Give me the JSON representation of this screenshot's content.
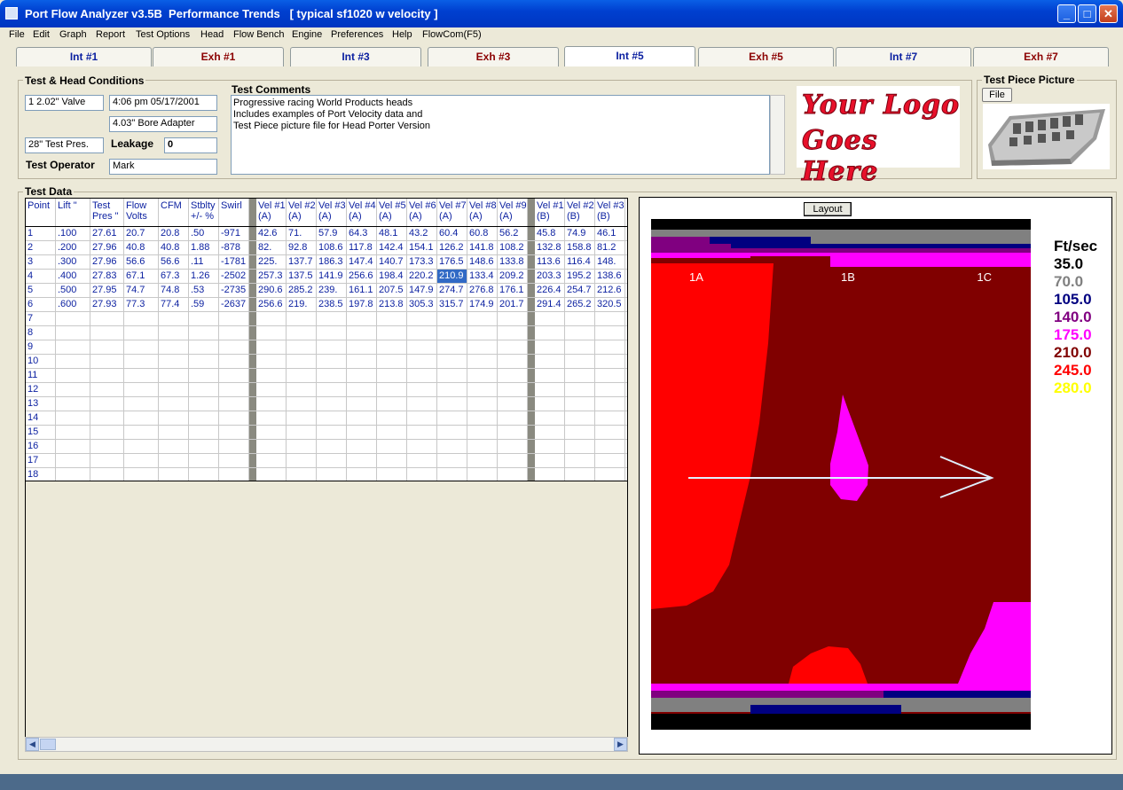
{
  "window": {
    "title": "Port Flow Analyzer v3.5B  Performance Trends   [ typical sf1020 w velocity ]"
  },
  "menu": [
    "File",
    "Edit",
    "Graph",
    "Report",
    "Test Options",
    "Head",
    "Flow Bench",
    "Engine",
    "Preferences",
    "Help",
    "FlowCom(F5)"
  ],
  "tabs": [
    {
      "label": "Int #1",
      "kind": "int"
    },
    {
      "label": "Exh #1",
      "kind": "exh"
    },
    {
      "label": "Int #3",
      "kind": "int"
    },
    {
      "label": "Exh #3",
      "kind": "exh"
    },
    {
      "label": "Int #5",
      "kind": "int",
      "active": true
    },
    {
      "label": "Exh #5",
      "kind": "exh"
    },
    {
      "label": "Int #7",
      "kind": "int"
    },
    {
      "label": "Exh #7",
      "kind": "exh"
    }
  ],
  "conditions": {
    "group_label": "Test & Head Conditions",
    "valve": "1  2.02\" Valve",
    "datetime": "4:06 pm  05/17/2001",
    "bore_adapter": "4.03\" Bore Adapter",
    "test_pres": "28\" Test Pres.",
    "leakage_label": "Leakage",
    "leakage_value": "0",
    "operator_label": "Test Operator",
    "operator_value": "Mark"
  },
  "comments": {
    "label": "Test Comments",
    "lines": [
      "Progressive racing World Products heads",
      "Includes examples of Port Velocity data and",
      "Test Piece picture file for Head Porter Version"
    ]
  },
  "logo": {
    "line1": "Your Logo",
    "line2": "Goes Here"
  },
  "picture": {
    "label": "Test Piece Picture",
    "file_button": "File"
  },
  "test_data": {
    "label": "Test Data",
    "columns": [
      "Point",
      "Lift \"",
      "Test Pres \"",
      "Flow Volts",
      "CFM",
      "Stblty +/- %",
      "Swirl",
      "Vel #1 (A)",
      "Vel #2 (A)",
      "Vel #3 (A)",
      "Vel #4 (A)",
      "Vel #5 (A)",
      "Vel #6 (A)",
      "Vel #7 (A)",
      "Vel #8 (A)",
      "Vel #9 (A)",
      "Vel #1 (B)",
      "Vel #2 (B)",
      "Vel #3 (B)"
    ],
    "rows": [
      [
        "1",
        ".100",
        "27.61",
        "20.7",
        "20.8",
        ".50",
        "-971",
        "42.6",
        "71.",
        "57.9",
        "64.3",
        "48.1",
        "43.2",
        "60.4",
        "60.8",
        "56.2",
        "45.8",
        "74.9",
        "46.1"
      ],
      [
        "2",
        ".200",
        "27.96",
        "40.8",
        "40.8",
        "1.88",
        "-878",
        "82.",
        "92.8",
        "108.6",
        "117.8",
        "142.4",
        "154.1",
        "126.2",
        "141.8",
        "108.2",
        "132.8",
        "158.8",
        "81.2"
      ],
      [
        "3",
        ".300",
        "27.96",
        "56.6",
        "56.6",
        ".11",
        "-1781",
        "225.",
        "137.7",
        "186.3",
        "147.4",
        "140.7",
        "173.3",
        "176.5",
        "148.6",
        "133.8",
        "113.6",
        "116.4",
        "148."
      ],
      [
        "4",
        ".400",
        "27.83",
        "67.1",
        "67.3",
        "1.26",
        "-2502",
        "257.3",
        "137.5",
        "141.9",
        "256.6",
        "198.4",
        "220.2",
        "210.9",
        "133.4",
        "209.2",
        "203.3",
        "195.2",
        "138.6"
      ],
      [
        "5",
        ".500",
        "27.95",
        "74.7",
        "74.8",
        ".53",
        "-2735",
        "290.6",
        "285.2",
        "239.",
        "161.1",
        "207.5",
        "147.9",
        "274.7",
        "276.8",
        "176.1",
        "226.4",
        "254.7",
        "212.6"
      ],
      [
        "6",
        ".600",
        "27.93",
        "77.3",
        "77.4",
        ".59",
        "-2637",
        "256.6",
        "219.",
        "238.5",
        "197.8",
        "213.8",
        "305.3",
        "315.7",
        "174.9",
        "201.7",
        "291.4",
        "265.2",
        "320.5"
      ],
      [
        "7"
      ],
      [
        "8"
      ],
      [
        "9"
      ],
      [
        "10"
      ],
      [
        "11"
      ],
      [
        "12"
      ],
      [
        "13"
      ],
      [
        "14"
      ],
      [
        "15"
      ],
      [
        "16"
      ],
      [
        "17"
      ],
      [
        "18"
      ]
    ],
    "selected_cell": {
      "row": 3,
      "col": 13
    }
  },
  "velocity_view": {
    "layout_button": "Layout",
    "position_labels": [
      "1A",
      "1B",
      "1C"
    ],
    "scale_title": "Ft/sec",
    "scale": [
      {
        "value": "35.0",
        "color": "#000000"
      },
      {
        "value": "70.0",
        "color": "#808080"
      },
      {
        "value": "105.0",
        "color": "#000080"
      },
      {
        "value": "140.0",
        "color": "#800080"
      },
      {
        "value": "175.0",
        "color": "#ff00ff"
      },
      {
        "value": "210.0",
        "color": "#800000"
      },
      {
        "value": "245.0",
        "color": "#ff0000"
      },
      {
        "value": "280.0",
        "color": "#ffff00"
      }
    ],
    "colors": {
      "black": "#000000",
      "gray": "#808080",
      "navy": "#000080",
      "purple": "#800080",
      "magenta": "#ff00ff",
      "maroon": "#800000",
      "red": "#ff0000",
      "arrow": "#e0f0ff"
    }
  }
}
